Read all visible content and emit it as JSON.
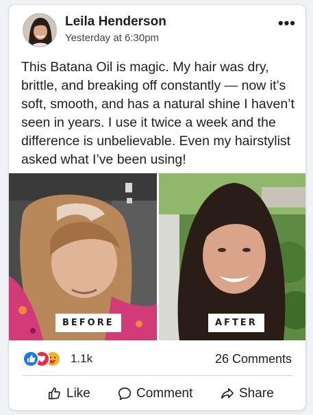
{
  "post": {
    "author": "Leila Henderson",
    "timestamp": "Yesterday at 6:30pm",
    "more_label": "•••",
    "text": "This Batana Oil is magic. My hair was dry, brittle, and breaking off constantly — now it’s soft, smooth, and has a natural shine I haven’t seen in years. I use it twice a week and the difference is unbelievable. Even my hairstylist asked what I’ve been using!",
    "photos": {
      "before_label": "BEFORE",
      "after_label": "AFTER"
    }
  },
  "engagement": {
    "reactions": [
      "like-icon",
      "love-icon",
      "care-icon"
    ],
    "reaction_count": "1.1k",
    "comments": "26 Comments"
  },
  "actions": {
    "like": "Like",
    "comment": "Comment",
    "share": "Share"
  },
  "colors": {
    "like_blue": "#1877f2",
    "love_red": "#f02849",
    "care_yellow": "#f7b125"
  }
}
